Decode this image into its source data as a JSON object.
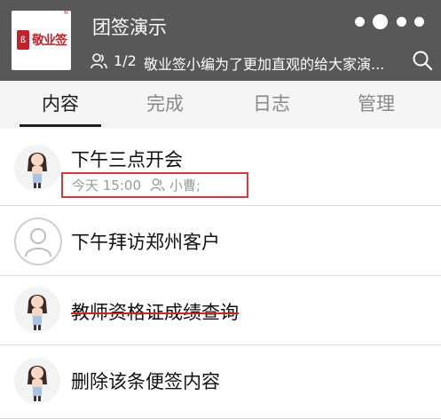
{
  "header": {
    "logo_text": "敬业签",
    "logo_mark": "ß",
    "logo_reg": "®",
    "title": "团签演示",
    "member_count": "1/2",
    "marquee": "敬业签小编为了更加直观的给大家演..."
  },
  "tabs": [
    {
      "label": "内容",
      "active": true
    },
    {
      "label": "完成",
      "active": false
    },
    {
      "label": "日志",
      "active": false
    },
    {
      "label": "管理",
      "active": false
    }
  ],
  "items": [
    {
      "title": "下午三点开会",
      "avatar": "girl-avatar",
      "completed": false,
      "meta_time": "今天 15:00",
      "meta_assignee": "小曹;"
    },
    {
      "title": "下午拜访郑州客户",
      "avatar": "generic-user-avatar",
      "completed": false
    },
    {
      "title": "教师资格证成绩查询",
      "avatar": "girl-avatar",
      "completed": true
    },
    {
      "title": "删除该条便签内容",
      "avatar": "girl-avatar",
      "completed": false
    }
  ],
  "colors": {
    "header_bg": "#585858",
    "highlight_border": "#d9363e",
    "strike": "#c62828"
  }
}
